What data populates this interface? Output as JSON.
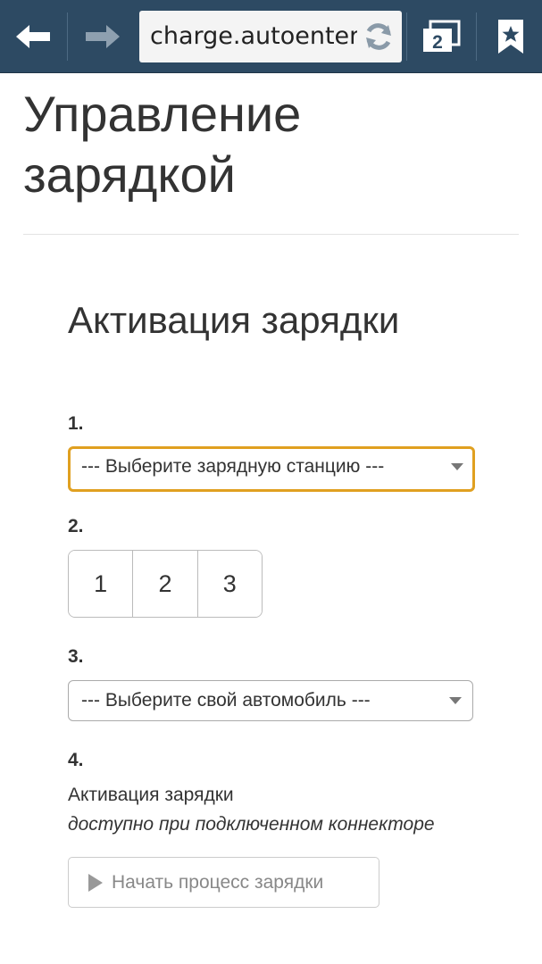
{
  "browser": {
    "url": "charge.autoenter",
    "tab_count": "2"
  },
  "page": {
    "title": "Управление зарядкой"
  },
  "activation": {
    "title": "Активация зарядки",
    "step1": {
      "label": "1.",
      "select_value": "--- Выберите зарядную станцию ---"
    },
    "step2": {
      "label": "2.",
      "options": [
        "1",
        "2",
        "3"
      ]
    },
    "step3": {
      "label": "3.",
      "select_value": "--- Выберите свой автомобиль ---"
    },
    "step4": {
      "label": "4.",
      "text": "Активация зарядки",
      "note": "доступно при подключенном коннекторе",
      "button_label": "Начать процесс зарядки"
    }
  },
  "colors": {
    "toolbar": "#2d4a63",
    "focus_border": "#e0a020"
  }
}
